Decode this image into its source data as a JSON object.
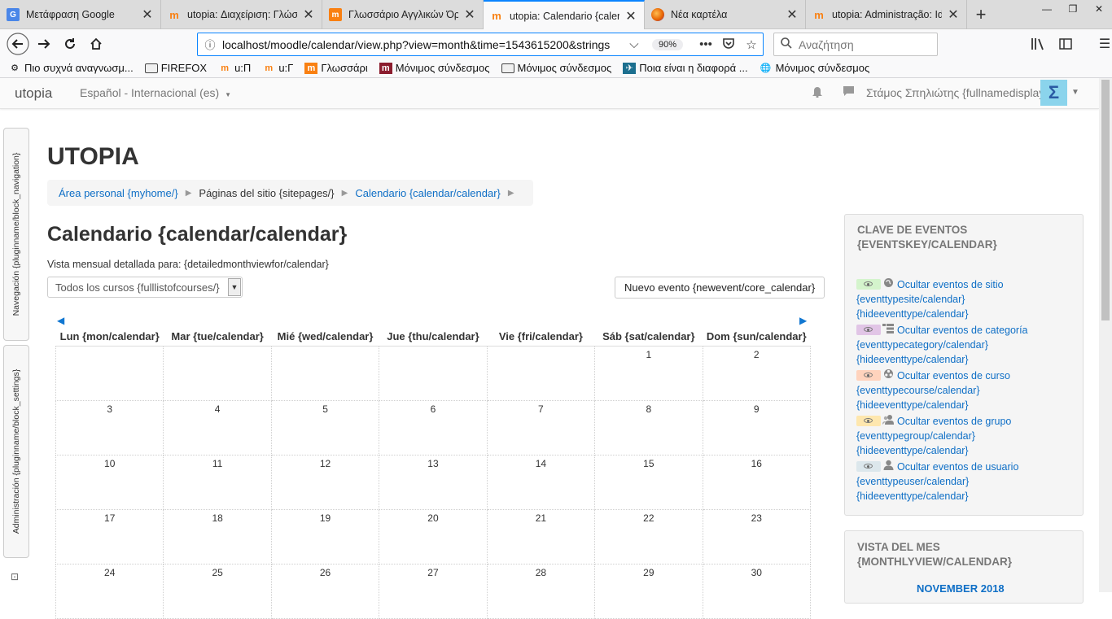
{
  "browser": {
    "tabs": [
      {
        "title": "Μετάφραση Google",
        "icon": "google-translate-icon",
        "color": "#4a86e8",
        "active": false
      },
      {
        "title": "utopia: Διαχείριση: Γλώσσ",
        "icon": "moodle-icon",
        "color": "#f98012",
        "active": false
      },
      {
        "title": "Γλωσσάριο Αγγλικών Όρ",
        "icon": "moodle-square-icon",
        "color": "#f98012",
        "active": false
      },
      {
        "title": "utopia: Calendario {calenc",
        "icon": "moodle-icon",
        "color": "#f98012",
        "active": true
      },
      {
        "title": "Νέα καρτέλα",
        "icon": "firefox-icon",
        "color": "#e66000",
        "active": false
      },
      {
        "title": "utopia: Administração: Idi",
        "icon": "moodle-icon",
        "color": "#f98012",
        "active": false
      }
    ],
    "url": "localhost/moodle/calendar/view.php?view=month&time=1543615200&strings",
    "zoom": "90%",
    "search_placeholder": "Αναζήτηση",
    "bookmarks": [
      {
        "label": "Πιο συχνά αναγνωσμ...",
        "icon": "gear-icon"
      },
      {
        "label": "FIREFOX",
        "icon": "folder-icon"
      },
      {
        "label": "u:Π",
        "icon": "moodle-icon"
      },
      {
        "label": "u:Γ",
        "icon": "moodle-icon"
      },
      {
        "label": "Γλωσσάρι",
        "icon": "moodle-square-icon"
      },
      {
        "label": "Μόνιμος σύνδεσμος",
        "icon": "m-icon"
      },
      {
        "label": "Μόνιμος σύνδεσμος",
        "icon": "folder-icon"
      },
      {
        "label": "Ποια είναι η διαφορά ...",
        "icon": "bird-icon"
      },
      {
        "label": "Μόνιμος σύνδεσμος",
        "icon": "globe-icon"
      }
    ]
  },
  "header": {
    "brand": "utopia",
    "language": "Español - Internacional (es)",
    "user": "Στάμος Σπηλιώτης {fullnamedisplay/}"
  },
  "sidebar": {
    "navigation": "Navegación {pluginname/block_navigation}",
    "administration": "Administración {pluginname/block_settings}"
  },
  "page": {
    "site_title": "UTOPIA",
    "breadcrumb": [
      "Área personal {myhome/}",
      "Páginas del sitio {sitepages/}",
      "Calendario {calendar/calendar}"
    ],
    "heading": "Calendario {calendar/calendar}",
    "detail_label": "Vista mensual detallada para: {detailedmonthviewfor/calendar}",
    "course_select": "Todos los cursos {fulllistofcourses/}",
    "new_event": "Nuevo evento {newevent/core_calendar}"
  },
  "calendar": {
    "weekdays": [
      "Lun {mon/calendar}",
      "Mar {tue/calendar}",
      "Mié {wed/calendar}",
      "Jue {thu/calendar}",
      "Vie {fri/calendar}",
      "Sáb {sat/calendar}",
      "Dom {sun/calendar}"
    ],
    "weeks": [
      [
        "",
        "",
        "",
        "",
        "",
        "1",
        "2"
      ],
      [
        "3",
        "4",
        "5",
        "6",
        "7",
        "8",
        "9"
      ],
      [
        "10",
        "11",
        "12",
        "13",
        "14",
        "15",
        "16"
      ],
      [
        "17",
        "18",
        "19",
        "20",
        "21",
        "22",
        "23"
      ],
      [
        "24",
        "25",
        "26",
        "27",
        "28",
        "29",
        "30"
      ]
    ]
  },
  "events_key": {
    "title_line1": "CLAVE DE EVENTOS",
    "title_line2": "{EVENTSKEY/CALENDAR}",
    "items": [
      {
        "line1": "Ocultar eventos de sitio",
        "line2": "{eventtypesite/calendar}",
        "line3": "{hideeventtype/calendar}",
        "color": "#d4f4cc",
        "icon": "globe-icon"
      },
      {
        "line1": "Ocultar eventos de categoría",
        "line2": "{eventtypecategory/calendar}",
        "line3": "{hideeventtype/calendar}",
        "color": "#e1c5e6",
        "icon": "category-icon"
      },
      {
        "line1": "Ocultar eventos de curso",
        "line2": "{eventtypecourse/calendar}",
        "line3": "{hideeventtype/calendar}",
        "color": "#ffd3bd",
        "icon": "course-icon"
      },
      {
        "line1": "Ocultar eventos de grupo",
        "line2": "{eventtypegroup/calendar}",
        "line3": "{hideeventtype/calendar}",
        "color": "#fee7ae",
        "icon": "group-icon"
      },
      {
        "line1": "Ocultar eventos de usuario",
        "line2": "{eventtypeuser/calendar}",
        "line3": "{hideeventtype/calendar}",
        "color": "#dce7ec",
        "icon": "user-icon"
      }
    ]
  },
  "monthly_view": {
    "title_line1": "VISTA DEL MES",
    "title_line2": "{MONTHLYVIEW/CALENDAR}",
    "month": "NOVEMBER 2018"
  }
}
